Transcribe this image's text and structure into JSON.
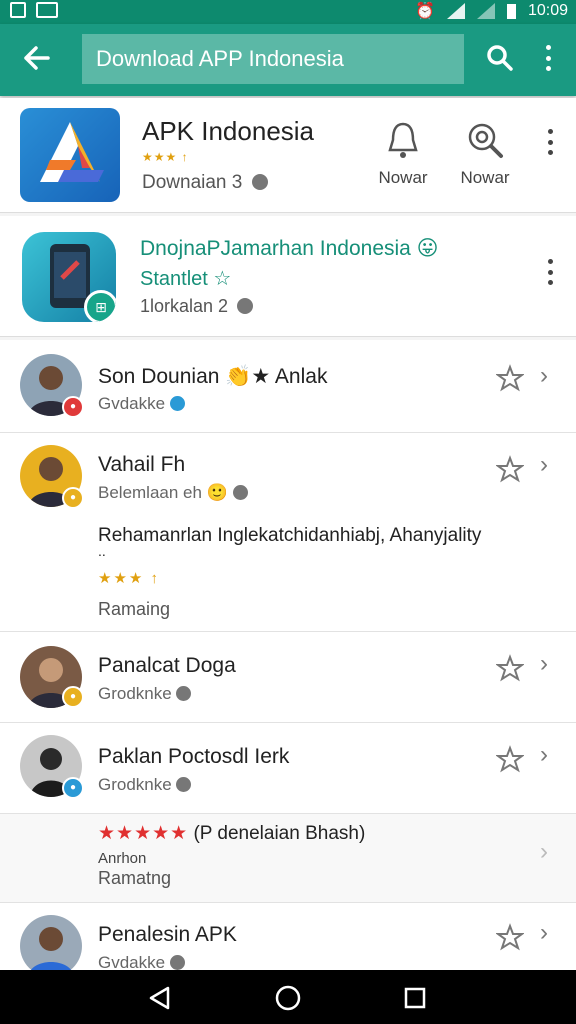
{
  "status_bar": {
    "time": "10:09"
  },
  "app_bar": {
    "search_value": "Download APP Indonesia"
  },
  "app_card": {
    "title": "APK Indonesia",
    "stars": "★★★ ↑",
    "subtitle": "Downaian 3",
    "actions": [
      {
        "label": "Nowar",
        "icon": "bell-icon"
      },
      {
        "label": "Nowar",
        "icon": "search-gear-icon"
      }
    ]
  },
  "promo_card": {
    "title": "DnojnaPJamarhan Indonesia 😛",
    "subtitle": "Stantlet ☆",
    "meta": "1lorkalan 2"
  },
  "list": [
    {
      "name": "Son Dounian 👏★ Anlak",
      "meta": "Gvdakke",
      "badge_color": "#e03a3a"
    },
    {
      "name": "Vahail Fh",
      "meta": "Belemlaan eh 🙂",
      "badge_color": "#e8b020",
      "review": "Rehamanrlan Inglekatchidanhiabj, Ahanyjality",
      "review_more": "..",
      "stars": "★★★ ↑",
      "rating_label": "Ramaing"
    },
    {
      "name": "Panalcat Doga",
      "meta": "Grodknke",
      "badge_color": "#e8b020"
    },
    {
      "name": "Paklan Poctosdl Ierk",
      "meta": "Grodknke",
      "badge_color": "#2a9ad6"
    },
    {
      "review_stars": "★★★★★",
      "review_title": "(P denelaian Bhash)",
      "author": "Anrhon",
      "rating_label": "Ramatng"
    },
    {
      "name": "Penalesin APK",
      "meta": "Gvdakke",
      "badge_color": "#2a9ad6"
    }
  ],
  "colors": {
    "accent": "#1a9a82",
    "status_bar": "#0d8a6e",
    "search_box": "#5bb8a6",
    "promo_text": "#168f78"
  }
}
